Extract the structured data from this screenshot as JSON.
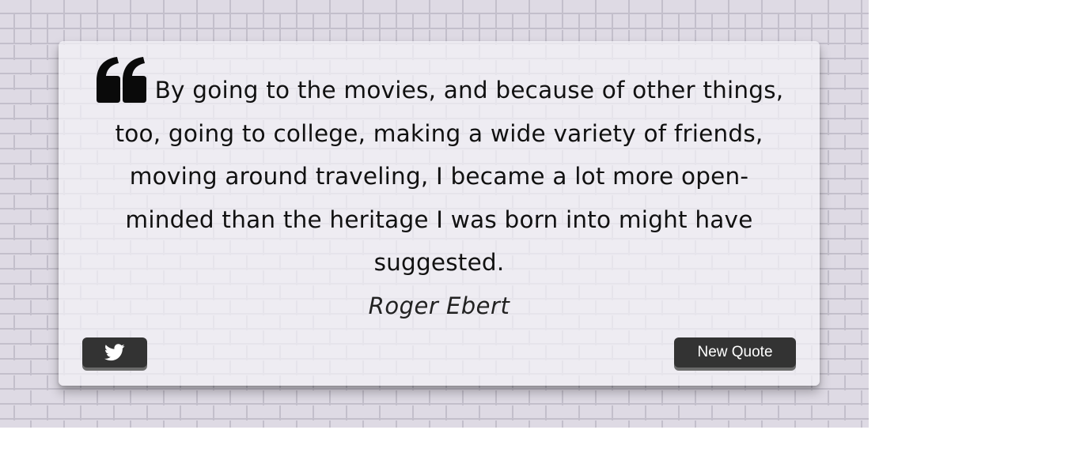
{
  "quote": {
    "text": "By going to the movies, and because of other things, too, going to college, making a wide variety of friends, moving around traveling, I became a lot more open-minded than the heritage I was born into might have suggested.",
    "author": "Roger Ebert",
    "icon": "quote-left-icon"
  },
  "actions": {
    "tweet_icon": "twitter-icon",
    "new_quote_label": "New Quote"
  },
  "colors": {
    "background": "#dedae4",
    "button": "#333333",
    "button_text": "#ffffff"
  }
}
